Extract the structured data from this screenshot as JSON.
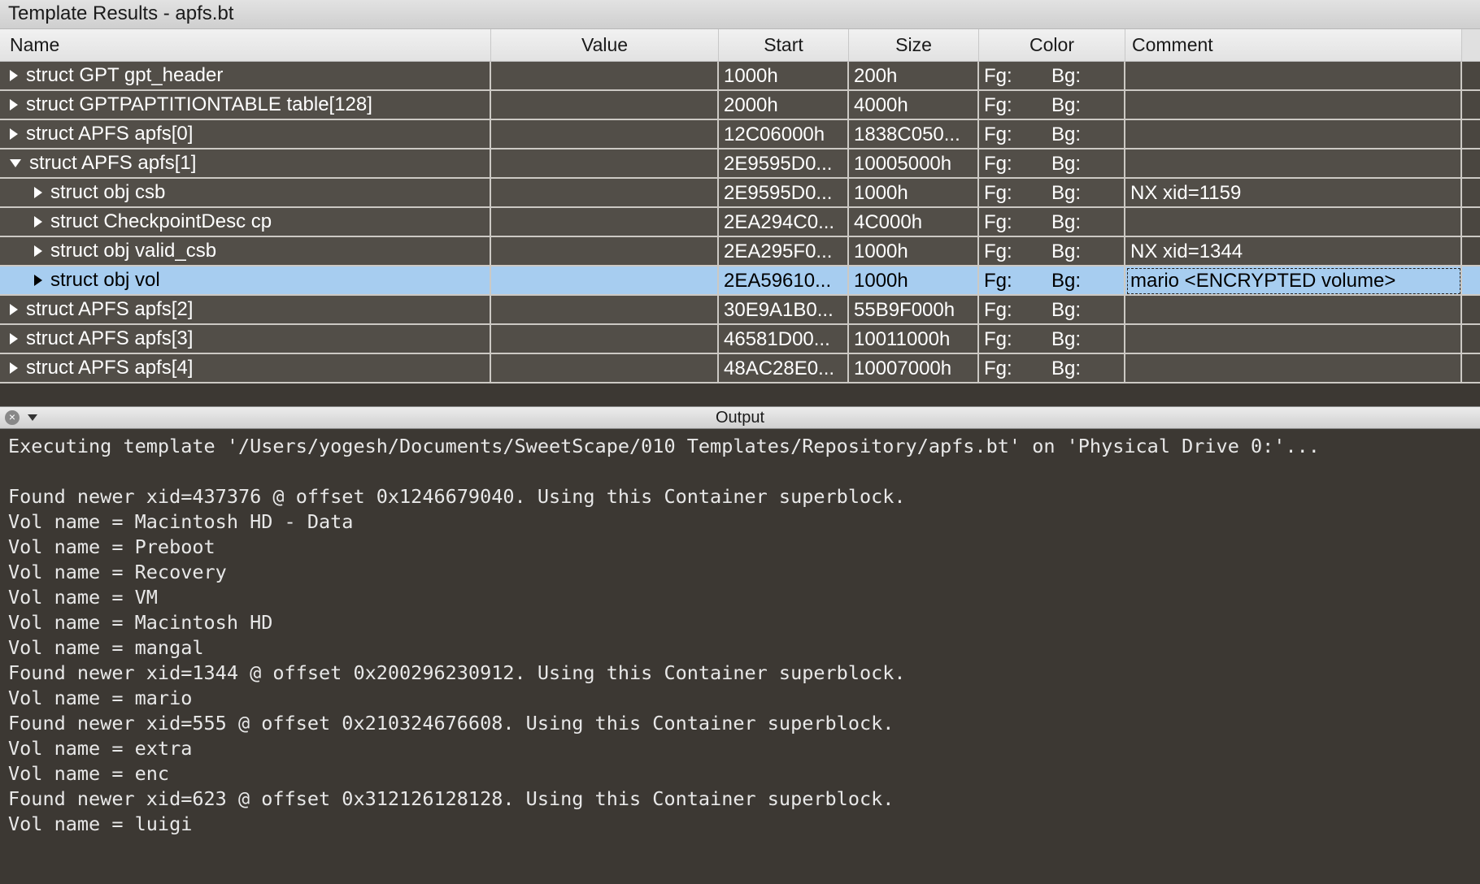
{
  "panel_title": "Template Results - apfs.bt",
  "columns": {
    "name": "Name",
    "value": "Value",
    "start": "Start",
    "size": "Size",
    "color": "Color",
    "comment": "Comment"
  },
  "color_labels": {
    "fg": "Fg:",
    "bg": "Bg:"
  },
  "rows": [
    {
      "indent": 0,
      "expanded": false,
      "name": "struct GPT gpt_header",
      "value": "",
      "start": "1000h",
      "size": "200h",
      "comment": "",
      "selected": false
    },
    {
      "indent": 0,
      "expanded": false,
      "name": "struct GPTPAPTITIONTABLE table[128]",
      "value": "",
      "start": "2000h",
      "size": "4000h",
      "comment": "",
      "selected": false
    },
    {
      "indent": 0,
      "expanded": false,
      "name": "struct APFS apfs[0]",
      "value": "",
      "start": "12C06000h",
      "size": "1838C050...",
      "comment": "",
      "selected": false
    },
    {
      "indent": 0,
      "expanded": true,
      "name": "struct APFS apfs[1]",
      "value": "",
      "start": "2E9595D0...",
      "size": "10005000h",
      "comment": "",
      "selected": false
    },
    {
      "indent": 1,
      "expanded": false,
      "name": "struct obj csb",
      "value": "",
      "start": "2E9595D0...",
      "size": "1000h",
      "comment": "NX xid=1159",
      "selected": false
    },
    {
      "indent": 1,
      "expanded": false,
      "name": "struct CheckpointDesc cp",
      "value": "",
      "start": "2EA294C0...",
      "size": "4C000h",
      "comment": "",
      "selected": false
    },
    {
      "indent": 1,
      "expanded": false,
      "name": "struct obj valid_csb",
      "value": "",
      "start": "2EA295F0...",
      "size": "1000h",
      "comment": "NX xid=1344",
      "selected": false
    },
    {
      "indent": 1,
      "expanded": false,
      "name": "struct obj vol",
      "value": "",
      "start": "2EA59610...",
      "size": "1000h",
      "comment": "mario <ENCRYPTED volume>",
      "selected": true
    },
    {
      "indent": 0,
      "expanded": false,
      "name": "struct APFS apfs[2]",
      "value": "",
      "start": "30E9A1B0...",
      "size": "55B9F000h",
      "comment": "",
      "selected": false
    },
    {
      "indent": 0,
      "expanded": false,
      "name": "struct APFS apfs[3]",
      "value": "",
      "start": "46581D00...",
      "size": "10011000h",
      "comment": "",
      "selected": false
    },
    {
      "indent": 0,
      "expanded": false,
      "name": "struct APFS apfs[4]",
      "value": "",
      "start": "48AC28E0...",
      "size": "10007000h",
      "comment": "",
      "selected": false
    }
  ],
  "output": {
    "title": "Output",
    "lines": [
      "Executing template '/Users/yogesh/Documents/SweetScape/010 Templates/Repository/apfs.bt' on 'Physical Drive 0:'...",
      "",
      "Found newer xid=437376 @ offset 0x1246679040. Using this Container superblock.",
      "Vol name = Macintosh HD - Data",
      "Vol name = Preboot",
      "Vol name = Recovery",
      "Vol name = VM",
      "Vol name = Macintosh HD",
      "Vol name = mangal",
      "Found newer xid=1344 @ offset 0x200296230912. Using this Container superblock.",
      "Vol name = mario",
      "Found newer xid=555 @ offset 0x210324676608. Using this Container superblock.",
      "Vol name = extra",
      "Vol name = enc",
      "Found newer xid=623 @ offset 0x312126128128. Using this Container superblock.",
      "Vol name = luigi"
    ]
  }
}
